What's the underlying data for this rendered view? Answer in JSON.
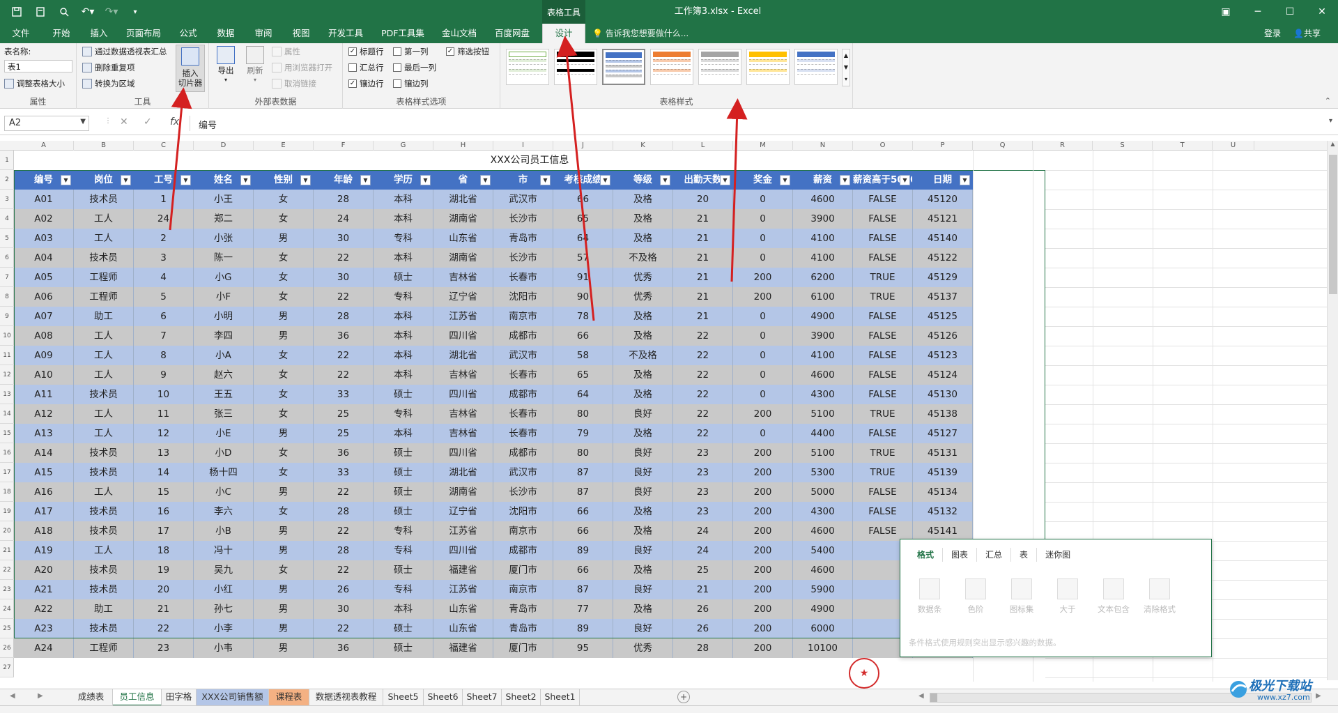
{
  "window": {
    "title": "工作簿3.xlsx - Excel",
    "context_tools_label": "表格工具"
  },
  "tabs": [
    "文件",
    "开始",
    "插入",
    "页面布局",
    "公式",
    "数据",
    "审阅",
    "视图",
    "开发工具",
    "PDF工具集",
    "金山文档",
    "百度网盘",
    "设计"
  ],
  "tellme": "告诉我您想要做什么...",
  "login": "登录",
  "share": "共享",
  "ribbon": {
    "props": {
      "table_name_label": "表名称:",
      "table_name_value": "表1",
      "resize": "调整表格大小",
      "group": "属性"
    },
    "tools": {
      "pivot": "通过数据透视表汇总",
      "dedupe": "删除重复项",
      "convert": "转换为区域",
      "slicer": "插入\n切片器",
      "group": "工具"
    },
    "external": {
      "export": "导出",
      "refresh": "刷新",
      "properties": "属性",
      "open_browser": "用浏览器打开",
      "unlink": "取消链接",
      "group": "外部表数据"
    },
    "style_options": {
      "header_row": "标题行",
      "total_row": "汇总行",
      "banded_rows": "镶边行",
      "first_col": "第一列",
      "last_col": "最后一列",
      "banded_cols": "镶边列",
      "filter_btn": "筛选按钮",
      "group": "表格样式选项"
    },
    "styles": {
      "group": "表格样式"
    }
  },
  "formula_bar": {
    "name_box": "A2",
    "content": "编号"
  },
  "columns": [
    "A",
    "B",
    "C",
    "D",
    "E",
    "F",
    "G",
    "H",
    "I",
    "J",
    "K",
    "L",
    "M",
    "N",
    "O",
    "P",
    "Q",
    "R",
    "S",
    "T",
    "U"
  ],
  "rows": [
    "1",
    "2",
    "3",
    "4",
    "5",
    "6",
    "7",
    "8",
    "9",
    "10",
    "11",
    "12",
    "13",
    "14",
    "15",
    "16",
    "17",
    "18",
    "19",
    "20",
    "21",
    "22",
    "23",
    "24",
    "25",
    "26",
    "27"
  ],
  "table": {
    "title": "XXX公司员工信息",
    "headers": [
      "编号",
      "岗位",
      "工号",
      "姓名",
      "性别",
      "年龄",
      "学历",
      "省",
      "市",
      "考核成绩",
      "等级",
      "出勤天数",
      "奖金",
      "薪资",
      "薪资高于5000",
      "日期"
    ],
    "rows": [
      [
        "A01",
        "技术员",
        "1",
        "小王",
        "女",
        "28",
        "本科",
        "湖北省",
        "武汉市",
        "66",
        "及格",
        "20",
        "0",
        "4600",
        "FALSE",
        "45120"
      ],
      [
        "A02",
        "工人",
        "24",
        "郑二",
        "女",
        "24",
        "本科",
        "湖南省",
        "长沙市",
        "65",
        "及格",
        "21",
        "0",
        "3900",
        "FALSE",
        "45121"
      ],
      [
        "A03",
        "工人",
        "2",
        "小张",
        "男",
        "30",
        "专科",
        "山东省",
        "青岛市",
        "64",
        "及格",
        "21",
        "0",
        "4100",
        "FALSE",
        "45140"
      ],
      [
        "A04",
        "技术员",
        "3",
        "陈一",
        "女",
        "22",
        "本科",
        "湖南省",
        "长沙市",
        "57",
        "不及格",
        "21",
        "0",
        "4100",
        "FALSE",
        "45122"
      ],
      [
        "A05",
        "工程师",
        "4",
        "小G",
        "女",
        "30",
        "硕士",
        "吉林省",
        "长春市",
        "91",
        "优秀",
        "21",
        "200",
        "6200",
        "TRUE",
        "45129"
      ],
      [
        "A06",
        "工程师",
        "5",
        "小F",
        "女",
        "22",
        "专科",
        "辽宁省",
        "沈阳市",
        "90",
        "优秀",
        "21",
        "200",
        "6100",
        "TRUE",
        "45137"
      ],
      [
        "A07",
        "助工",
        "6",
        "小明",
        "男",
        "28",
        "本科",
        "江苏省",
        "南京市",
        "78",
        "及格",
        "21",
        "0",
        "4900",
        "FALSE",
        "45125"
      ],
      [
        "A08",
        "工人",
        "7",
        "李四",
        "男",
        "36",
        "本科",
        "四川省",
        "成都市",
        "66",
        "及格",
        "22",
        "0",
        "3900",
        "FALSE",
        "45126"
      ],
      [
        "A09",
        "工人",
        "8",
        "小A",
        "女",
        "22",
        "本科",
        "湖北省",
        "武汉市",
        "58",
        "不及格",
        "22",
        "0",
        "4100",
        "FALSE",
        "45123"
      ],
      [
        "A10",
        "工人",
        "9",
        "赵六",
        "女",
        "22",
        "本科",
        "吉林省",
        "长春市",
        "65",
        "及格",
        "22",
        "0",
        "4600",
        "FALSE",
        "45124"
      ],
      [
        "A11",
        "技术员",
        "10",
        "王五",
        "女",
        "33",
        "硕士",
        "四川省",
        "成都市",
        "64",
        "及格",
        "22",
        "0",
        "4300",
        "FALSE",
        "45130"
      ],
      [
        "A12",
        "工人",
        "11",
        "张三",
        "女",
        "25",
        "专科",
        "吉林省",
        "长春市",
        "80",
        "良好",
        "22",
        "200",
        "5100",
        "TRUE",
        "45138"
      ],
      [
        "A13",
        "工人",
        "12",
        "小E",
        "男",
        "25",
        "本科",
        "吉林省",
        "长春市",
        "79",
        "及格",
        "22",
        "0",
        "4400",
        "FALSE",
        "45127"
      ],
      [
        "A14",
        "技术员",
        "13",
        "小D",
        "女",
        "36",
        "硕士",
        "四川省",
        "成都市",
        "80",
        "良好",
        "23",
        "200",
        "5100",
        "TRUE",
        "45131"
      ],
      [
        "A15",
        "技术员",
        "14",
        "杨十四",
        "女",
        "33",
        "硕士",
        "湖北省",
        "武汉市",
        "87",
        "良好",
        "23",
        "200",
        "5300",
        "TRUE",
        "45139"
      ],
      [
        "A16",
        "工人",
        "15",
        "小C",
        "男",
        "22",
        "硕士",
        "湖南省",
        "长沙市",
        "87",
        "良好",
        "23",
        "200",
        "5000",
        "FALSE",
        "45134"
      ],
      [
        "A17",
        "技术员",
        "16",
        "李六",
        "女",
        "28",
        "硕士",
        "辽宁省",
        "沈阳市",
        "66",
        "及格",
        "23",
        "200",
        "4300",
        "FALSE",
        "45132"
      ],
      [
        "A18",
        "技术员",
        "17",
        "小B",
        "男",
        "22",
        "专科",
        "江苏省",
        "南京市",
        "66",
        "及格",
        "24",
        "200",
        "4600",
        "FALSE",
        "45141"
      ],
      [
        "A19",
        "工人",
        "18",
        "冯十",
        "男",
        "28",
        "专科",
        "四川省",
        "成都市",
        "89",
        "良好",
        "24",
        "200",
        "5400",
        "",
        ""
      ],
      [
        "A20",
        "技术员",
        "19",
        "吴九",
        "女",
        "22",
        "硕士",
        "福建省",
        "厦门市",
        "66",
        "及格",
        "25",
        "200",
        "4600",
        "",
        ""
      ],
      [
        "A21",
        "技术员",
        "20",
        "小红",
        "男",
        "26",
        "专科",
        "江苏省",
        "南京市",
        "87",
        "良好",
        "21",
        "200",
        "5900",
        "",
        ""
      ],
      [
        "A22",
        "助工",
        "21",
        "孙七",
        "男",
        "30",
        "本科",
        "山东省",
        "青岛市",
        "77",
        "及格",
        "26",
        "200",
        "4900",
        "",
        ""
      ],
      [
        "A23",
        "技术员",
        "22",
        "小李",
        "男",
        "22",
        "硕士",
        "山东省",
        "青岛市",
        "89",
        "良好",
        "26",
        "200",
        "6000",
        "",
        ""
      ],
      [
        "A24",
        "工程师",
        "23",
        "小韦",
        "男",
        "36",
        "硕士",
        "福建省",
        "厦门市",
        "95",
        "优秀",
        "28",
        "200",
        "10100",
        "",
        ""
      ]
    ]
  },
  "quick_analysis": {
    "tabs": [
      "格式",
      "图表",
      "汇总",
      "表",
      "迷你图"
    ],
    "items": [
      "数据条",
      "色阶",
      "图标集",
      "大于",
      "文本包含",
      "清除格式"
    ],
    "hint": "条件格式使用规则突出显示感兴趣的数据。"
  },
  "sheet_tabs": [
    "成绩表",
    "员工信息",
    "田字格",
    "XXX公司销售额",
    "课程表",
    "数据透视表教程",
    "Sheet5",
    "Sheet6",
    "Sheet7",
    "Sheet2",
    "Sheet1"
  ],
  "active_sheet": "员工信息",
  "seal_glyph": "★",
  "watermark": {
    "title": "极光下载站",
    "url": "www.xz7.com"
  },
  "colors": {
    "accent": "#217346",
    "header": "#4472c4",
    "band_a": "#b4c6e7",
    "band_b": "#c9c9c9",
    "arrow": "#d42020"
  }
}
